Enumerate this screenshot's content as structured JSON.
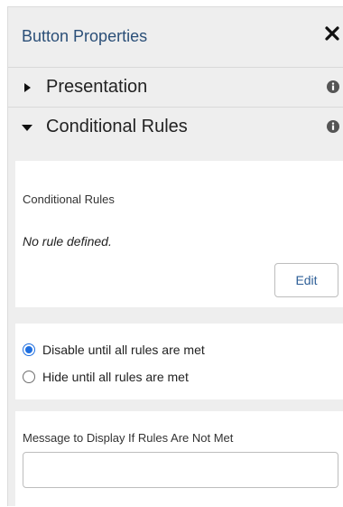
{
  "header": {
    "title": "Button Properties",
    "close_icon": "close-icon",
    "title_color": "#2b4f78"
  },
  "sections": {
    "presentation": {
      "label": "Presentation",
      "expanded": false,
      "caret_icon": "caret-right-icon",
      "info_icon": "info-icon"
    },
    "conditional": {
      "label": "Conditional Rules",
      "expanded": true,
      "caret_icon": "caret-down-icon",
      "info_icon": "info-icon"
    }
  },
  "rules_card": {
    "title": "Conditional Rules",
    "empty_text": "No rule defined.",
    "edit_label": "Edit"
  },
  "options": {
    "selected": "disable",
    "items": [
      {
        "label": "Disable until all rules are met",
        "checked": true
      },
      {
        "label": "Hide until all rules are met",
        "checked": false
      }
    ],
    "accent_color": "#1f6fe0"
  },
  "message": {
    "label": "Message to Display If Rules Are Not Met",
    "value": "",
    "placeholder": ""
  }
}
